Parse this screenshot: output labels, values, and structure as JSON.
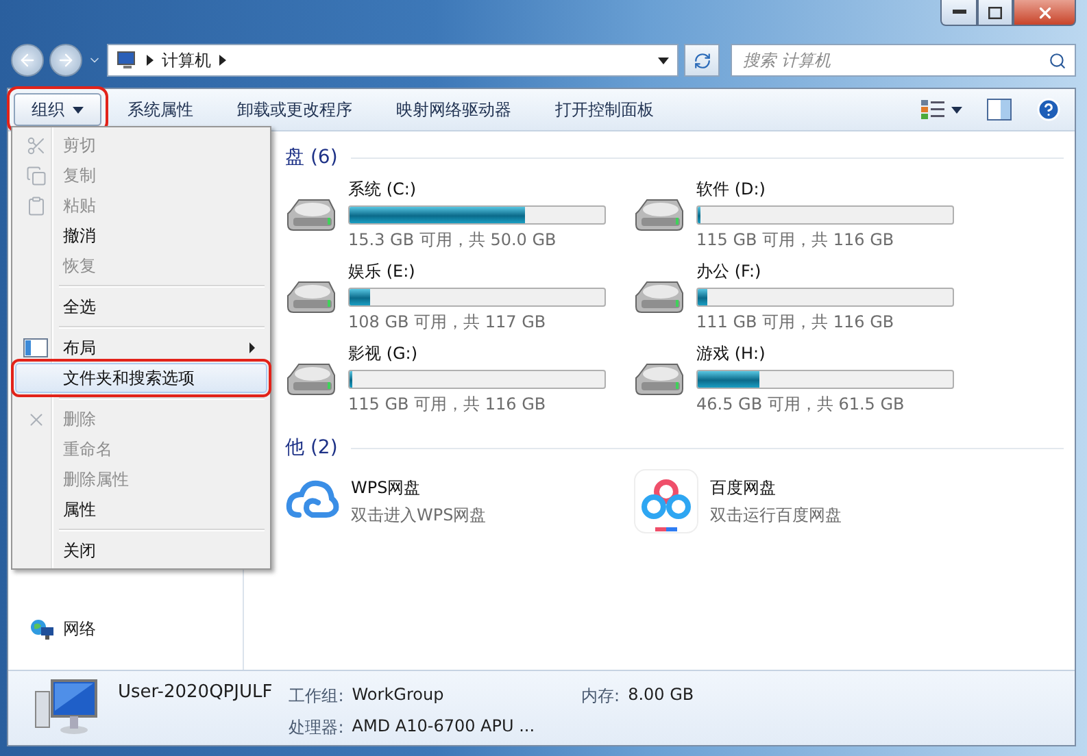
{
  "window": {
    "caption_buttons": [
      {
        "kind": "minimize"
      },
      {
        "kind": "maximize"
      },
      {
        "kind": "close"
      }
    ]
  },
  "address_bar": {
    "path": [
      "计算机"
    ]
  },
  "search": {
    "placeholder": "搜索 计算机"
  },
  "toolbar": {
    "items": [
      {
        "label": "组织",
        "dropdown": true,
        "pressed": true,
        "annotated": true
      },
      {
        "label": "系统属性",
        "dropdown": false,
        "pressed": false,
        "annotated": false
      },
      {
        "label": "卸载或更改程序",
        "dropdown": false,
        "pressed": false,
        "annotated": false
      },
      {
        "label": "映射网络驱动器",
        "dropdown": false,
        "pressed": false,
        "annotated": false
      },
      {
        "label": "打开控制面板",
        "dropdown": false,
        "pressed": false,
        "annotated": false
      }
    ]
  },
  "organize_menu": [
    {
      "kind": "item",
      "label": "剪切",
      "disabled": true,
      "submenu": false,
      "selected": false,
      "annotated": false
    },
    {
      "kind": "item",
      "label": "复制",
      "disabled": true,
      "submenu": false,
      "selected": false,
      "annotated": false
    },
    {
      "kind": "item",
      "label": "粘贴",
      "disabled": true,
      "submenu": false,
      "selected": false,
      "annotated": false
    },
    {
      "kind": "item",
      "label": "撤消",
      "disabled": false,
      "submenu": false,
      "selected": false,
      "annotated": false
    },
    {
      "kind": "item",
      "label": "恢复",
      "disabled": true,
      "submenu": false,
      "selected": false,
      "annotated": false
    },
    {
      "kind": "separator"
    },
    {
      "kind": "item",
      "label": "全选",
      "disabled": false,
      "submenu": false,
      "selected": false,
      "annotated": false
    },
    {
      "kind": "separator"
    },
    {
      "kind": "item",
      "label": "布局",
      "disabled": false,
      "submenu": true,
      "selected": false,
      "annotated": false
    },
    {
      "kind": "item",
      "label": "文件夹和搜索选项",
      "disabled": false,
      "submenu": false,
      "selected": true,
      "annotated": true
    },
    {
      "kind": "separator"
    },
    {
      "kind": "item",
      "label": "删除",
      "disabled": true,
      "submenu": false,
      "selected": false,
      "annotated": false
    },
    {
      "kind": "item",
      "label": "重命名",
      "disabled": true,
      "submenu": false,
      "selected": false,
      "annotated": false
    },
    {
      "kind": "item",
      "label": "删除属性",
      "disabled": true,
      "submenu": false,
      "selected": false,
      "annotated": false
    },
    {
      "kind": "item",
      "label": "属性",
      "disabled": false,
      "submenu": false,
      "selected": false,
      "annotated": false
    },
    {
      "kind": "separator"
    },
    {
      "kind": "item",
      "label": "关闭",
      "disabled": false,
      "submenu": false,
      "selected": false,
      "annotated": false
    }
  ],
  "nav_pane": {
    "items": [
      {
        "label": "网络"
      }
    ]
  },
  "sections": [
    {
      "title": "盘 (6)",
      "kind": "drives",
      "items": [
        {
          "name": "系统 (C:)",
          "level": 0.69,
          "reading": "15.3 GB 可用，共 50.0 GB"
        },
        {
          "name": "软件 (D:)",
          "level": 0.01,
          "reading": "115 GB 可用，共 116 GB"
        },
        {
          "name": "娱乐 (E:)",
          "level": 0.08,
          "reading": "108 GB 可用，共 117 GB"
        },
        {
          "name": "办公 (F:)",
          "level": 0.04,
          "reading": "111 GB 可用，共 116 GB"
        },
        {
          "name": "影视 (G:)",
          "level": 0.01,
          "reading": "115 GB 可用，共 116 GB"
        },
        {
          "name": "游戏 (H:)",
          "level": 0.24,
          "reading": "46.5 GB 可用，共 61.5 GB"
        }
      ]
    },
    {
      "title": "他 (2)",
      "kind": "apps",
      "items": [
        {
          "name": "WPS网盘",
          "description": "双击进入WPS网盘"
        },
        {
          "name": "百度网盘",
          "description": "双击运行百度网盘"
        }
      ]
    }
  ],
  "details": {
    "computer_name": "User-2020QPJULF",
    "fields": [
      {
        "label": "工作组:",
        "value": "WorkGroup"
      },
      {
        "label": "内存:",
        "value": "8.00 GB"
      },
      {
        "label": "处理器:",
        "value": "AMD A10-6700 APU ..."
      }
    ]
  }
}
